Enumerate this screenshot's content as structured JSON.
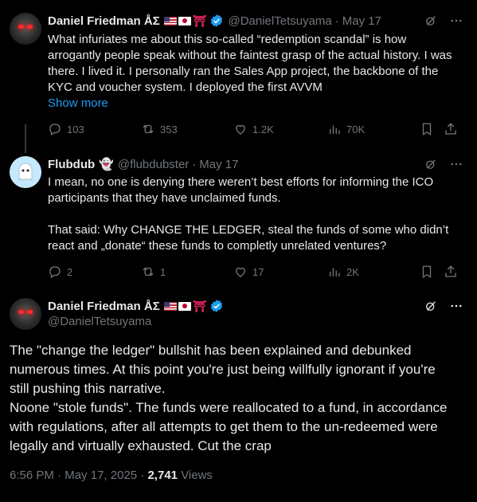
{
  "tweet1": {
    "name": "Daniel Friedman ÅΣ",
    "handle": "@DanielTetsuyama",
    "dot": "·",
    "date": "May 17",
    "text_lines": [
      "What infuriates me about this so-called “redemption scandal” is how",
      "arrogantly people speak without the faintest grasp of the actual history. I was",
      "there. I lived it. I personally ran the Sales App project, the backbone of the",
      "KYC and voucher system. I deployed the first AVVM"
    ],
    "show_more": "Show more",
    "replies": "103",
    "reposts": "353",
    "likes": "1.2K",
    "views": "70K"
  },
  "tweet2": {
    "name": "Flubdub",
    "handle": "@flubdubster",
    "dot": "·",
    "date": "May 17",
    "text_lines": [
      "I mean, no one is denying there weren’t best efforts for informing the ICO",
      "participants that they have unclaimed funds.",
      "",
      "That said: Why CHANGE THE LEDGER, steal the funds of some who didn’t",
      "react and „donate“ these funds to completly unrelated ventures?"
    ],
    "replies": "2",
    "reposts": "1",
    "likes": "17",
    "views": "2K"
  },
  "tweet3": {
    "name": "Daniel Friedman ÅΣ",
    "handle": "@DanielTetsuyama",
    "text_lines": [
      "The \"change the ledger\" bullshit has been explained and debunked",
      "numerous times. At this point you're just being willfully ignorant if you're",
      "still pushing this narrative.",
      "Noone \"stole funds\". The funds were reallocated to a fund, in accordance",
      "with regulations, after all attempts to get them to the un-redeemed were",
      "legally and virtually exhausted. Cut the crap"
    ],
    "time": "6:56 PM",
    "sep": "·",
    "date": "May 17, 2025",
    "sep2": "·",
    "views_count": "2,741",
    "views_label": "Views"
  },
  "icons": {
    "grok": "grok-icon",
    "more": "more-icon",
    "reply": "reply-icon",
    "repost": "repost-icon",
    "like": "like-icon",
    "views": "views-icon",
    "bookmark": "bookmark-icon",
    "share": "share-icon",
    "verified": "verified-icon",
    "ghost": "ghost-icon",
    "torii": "⛩"
  },
  "colors": {
    "bg": "#000000",
    "text": "#e7e9ea",
    "muted": "#71767b",
    "accent": "#1d9bf0"
  }
}
